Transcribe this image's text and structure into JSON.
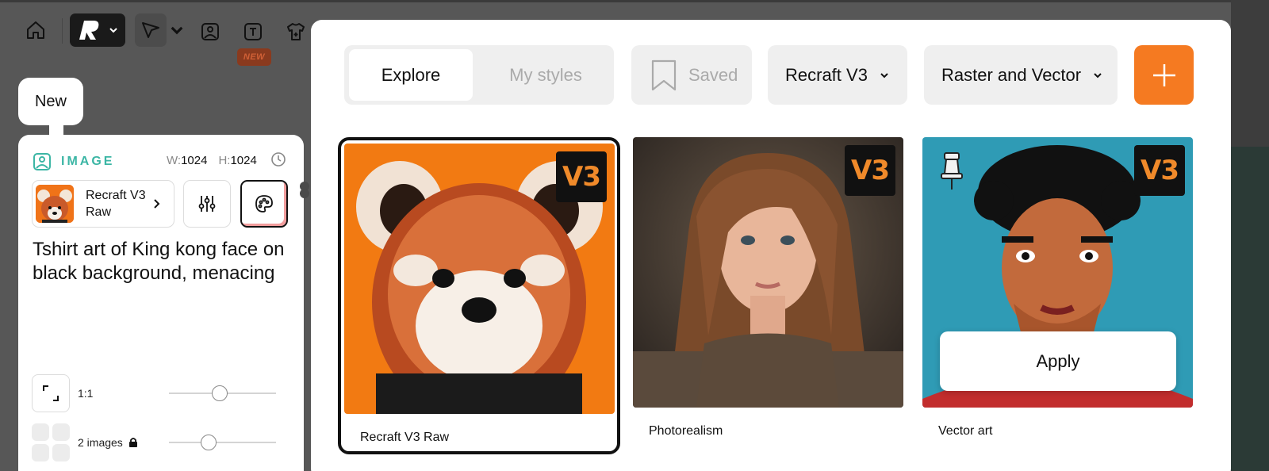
{
  "toolbar": {
    "new_badge": "NEW"
  },
  "left_panel": {
    "new_label": "New",
    "section_label": "IMAGE",
    "width_label": "W:",
    "width_value": "1024",
    "height_label": "H:",
    "height_value": "1024",
    "model_name": "Recraft V3 Raw",
    "prompt": "Tshirt art of King kong face on black background, menacing",
    "ratio_label": "1:1",
    "ratio_slider_fraction": 0.48,
    "images_label": "2 images",
    "images_slider_fraction": 0.36
  },
  "style_panel": {
    "tabs": [
      {
        "label": "Explore",
        "active": true
      },
      {
        "label": "My styles",
        "active": false
      }
    ],
    "saved_label": "Saved",
    "model_select": "Recraft V3",
    "format_select": "Raster and Vector",
    "accent_color": "#f57a21",
    "cards": [
      {
        "label": "Recraft V3 Raw",
        "badge": "V3",
        "selected": true
      },
      {
        "label": "Photorealism",
        "badge": "V3",
        "selected": false
      },
      {
        "label": "Vector art",
        "badge": "V3",
        "selected": false,
        "action": "Apply"
      }
    ]
  }
}
